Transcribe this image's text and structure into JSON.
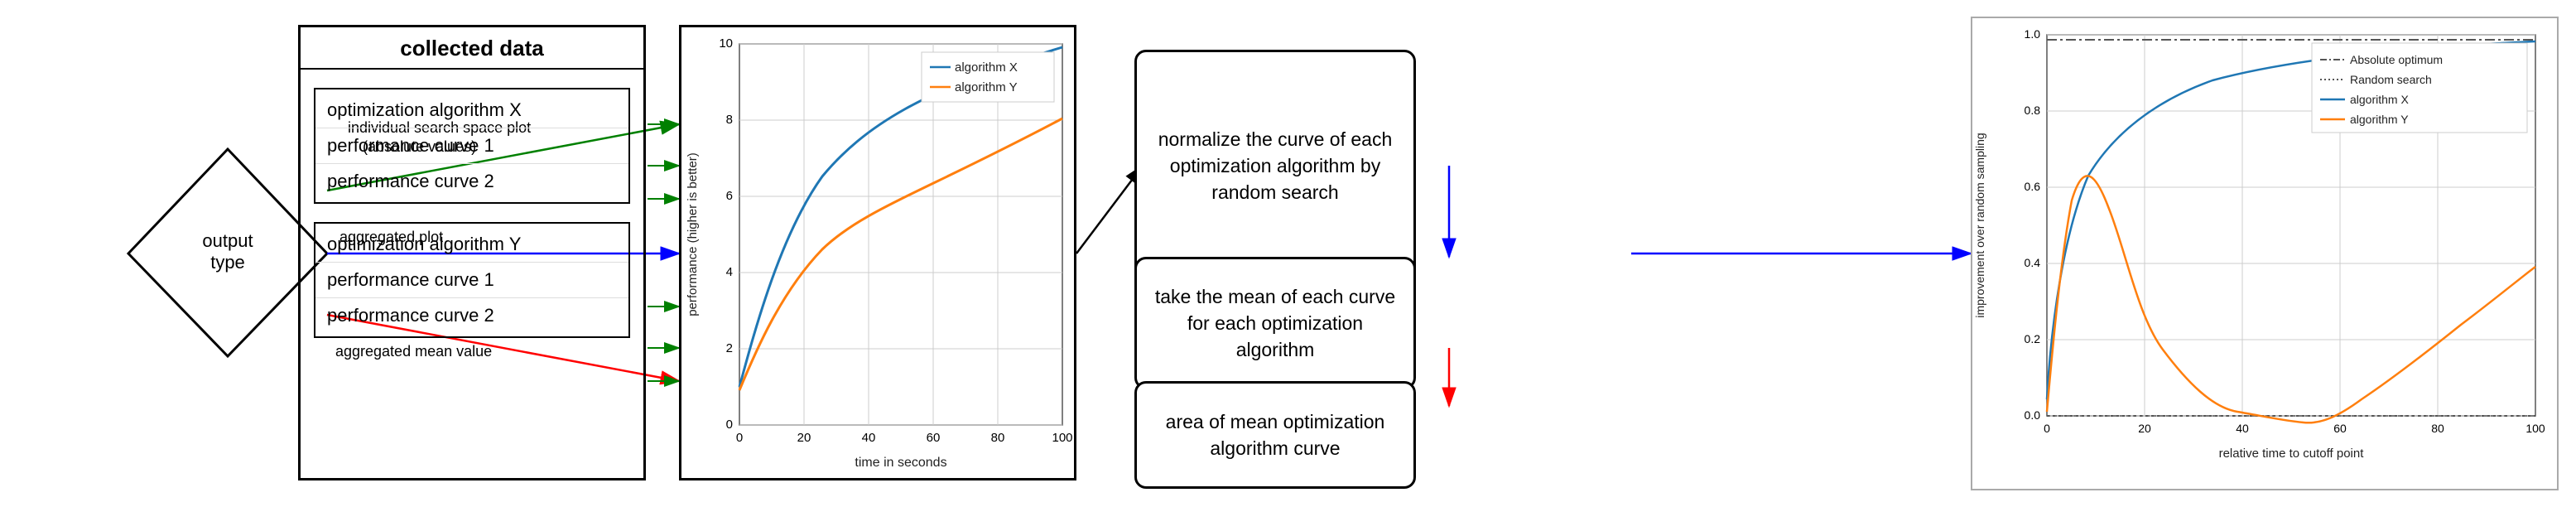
{
  "diamond": {
    "label": "output type"
  },
  "arrows": {
    "individual": "individual search space plot\n(absolute values)",
    "aggregated_plot": "aggregated plot",
    "aggregated_mean": "aggregated mean value"
  },
  "collected_data": {
    "title": "collected data",
    "groups": [
      {
        "name": "optimization algorithm X",
        "curves": [
          "performance curve 1",
          "performance curve 2"
        ]
      },
      {
        "name": "optimization algorithm Y",
        "curves": [
          "performance curve 1",
          "performance curve 2"
        ]
      }
    ]
  },
  "chart": {
    "title": "",
    "y_label": "performance (higher is better)",
    "x_label": "time in seconds",
    "y_max": 10,
    "x_max": 100,
    "x_ticks": [
      0,
      20,
      40,
      60,
      80,
      100
    ],
    "y_ticks": [
      2,
      4,
      6,
      8,
      10
    ],
    "legend": [
      {
        "label": "algorithm X",
        "color": "#1f77b4"
      },
      {
        "label": "algorithm Y",
        "color": "#ff7f0e"
      }
    ]
  },
  "process_boxes": {
    "normalize": "normalize the curve of each optimization algorithm by random search",
    "mean": "take the mean of each curve for each optimization algorithm",
    "area": "area of mean optimization algorithm curve"
  },
  "final_chart": {
    "y_label": "improvement over random sampling",
    "x_label": "relative time to cutoff point",
    "y_max": 1.0,
    "x_max": 100,
    "x_ticks": [
      0,
      20,
      40,
      60,
      80,
      100
    ],
    "y_ticks": [
      0.0,
      0.2,
      0.4,
      0.6,
      0.8,
      1.0
    ],
    "legend": [
      {
        "label": "Absolute optimum",
        "color": "#555",
        "style": "dashdot"
      },
      {
        "label": "Random search",
        "color": "#555",
        "style": "dotted"
      },
      {
        "label": "algorithm X",
        "color": "#1f77b4",
        "style": "solid"
      },
      {
        "label": "algorithm Y",
        "color": "#ff7f0e",
        "style": "solid"
      }
    ]
  }
}
